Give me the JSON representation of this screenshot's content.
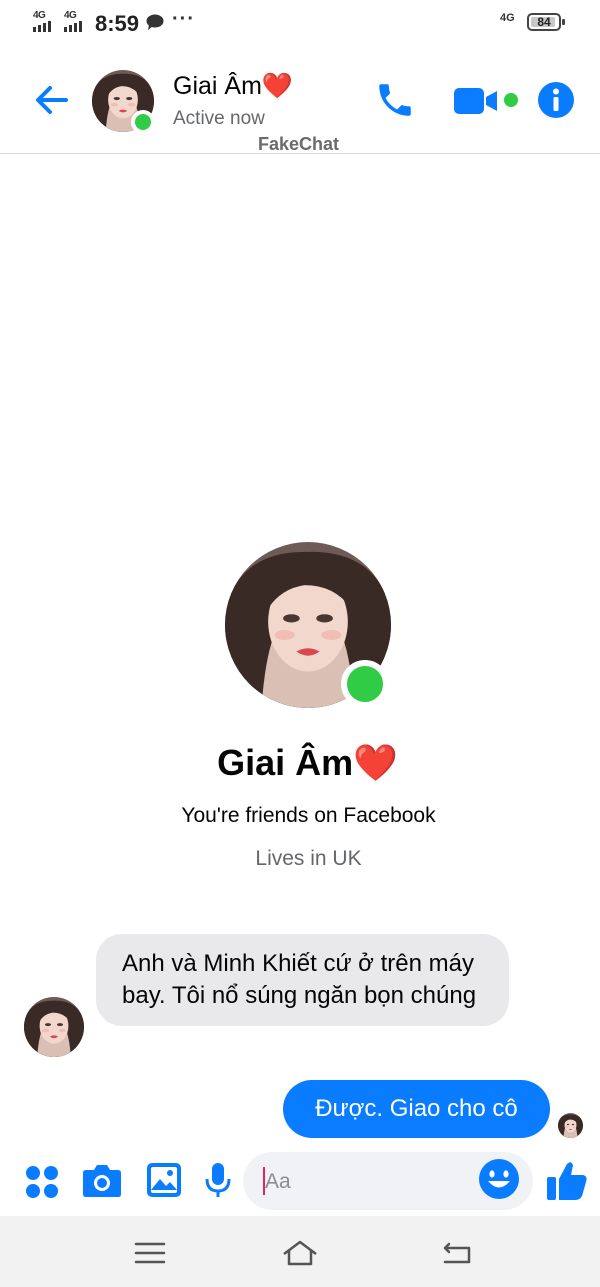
{
  "status_bar": {
    "sim1": "4G",
    "sim2": "4G",
    "time": "8:59",
    "overflow": "···",
    "network": "4G",
    "battery": "84",
    "icons": [
      "signal-bars-icon",
      "message-bubble-icon",
      "battery-icon"
    ]
  },
  "header": {
    "contact_name": "Giai Âm",
    "heart": "❤️",
    "status": "Active now",
    "brand": "FakeChat",
    "icons": [
      "back-arrow-icon",
      "phone-icon",
      "video-camera-icon",
      "info-icon"
    ]
  },
  "profile": {
    "name": "Giai Âm",
    "heart": "❤️",
    "friends_text": "You're friends on Facebook",
    "lives_text": "Lives in UK"
  },
  "messages": [
    {
      "from": "contact",
      "text": "Anh và Minh Khiết cứ ở trên máy bay. Tôi nổ súng ngăn bọn chúng"
    },
    {
      "from": "me",
      "text": "Được. Giao cho cô"
    }
  ],
  "composer": {
    "placeholder": "Aa",
    "icons": [
      "apps-grid-icon",
      "camera-icon",
      "gallery-icon",
      "microphone-icon",
      "emoji-icon",
      "thumbs-up-icon"
    ]
  },
  "nav_bar": {
    "icons": [
      "menu-icon",
      "home-icon",
      "back-icon"
    ]
  },
  "colors": {
    "accent": "#0a7cff",
    "online": "#31cc46",
    "incoming_bubble": "#e9e9eb",
    "secondary_text": "#65676b"
  }
}
